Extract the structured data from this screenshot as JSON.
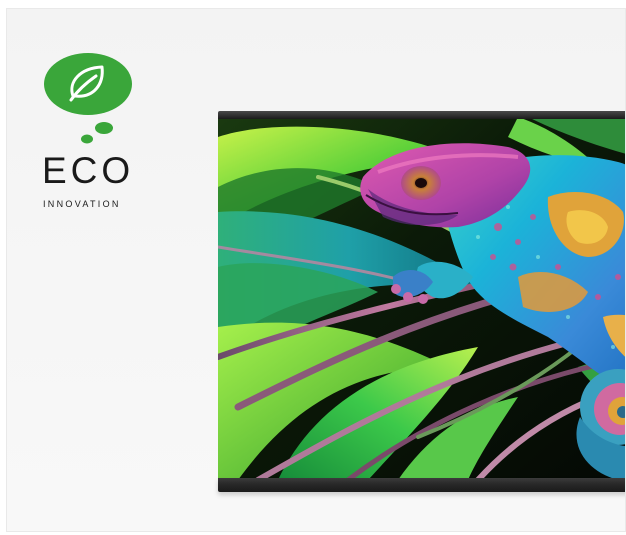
{
  "logo": {
    "word": "ECO",
    "subtitle": "INNOVATION",
    "bubble_color": "#3aa63a"
  },
  "tv_screen": {
    "image": "chameleon-on-leaves"
  }
}
